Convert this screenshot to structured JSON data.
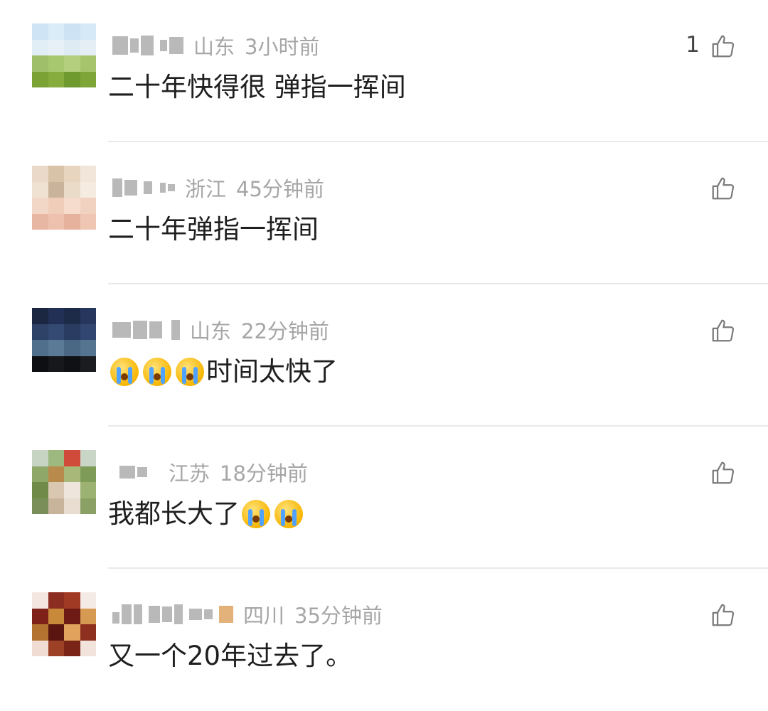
{
  "comments": [
    {
      "location": "山东",
      "time": "3小时前",
      "text": "二十年快得很 弹指一挥间",
      "like_count": "1",
      "emoji_count": 0
    },
    {
      "location": "浙江",
      "time": "45分钟前",
      "text": "二十年弹指一挥间",
      "like_count": "",
      "emoji_count": 0
    },
    {
      "location": "山东",
      "time": "22分钟前",
      "text": "时间太快了",
      "like_count": "",
      "emoji_count": 3,
      "emoji_position": "before"
    },
    {
      "location": "江苏",
      "time": "18分钟前",
      "text": "我都长大了",
      "like_count": "",
      "emoji_count": 2,
      "emoji_position": "after"
    },
    {
      "location": "四川",
      "time": "35分钟前",
      "text": "又一个20年过去了。",
      "like_count": "",
      "emoji_count": 0
    }
  ],
  "icons": {
    "like": "thumbs-up-icon",
    "emoji": "crying-face-icon"
  },
  "colors": {
    "meta_text": "#a6a6a6",
    "comment_text": "#1f1f1f",
    "divider": "#e9e9e9"
  }
}
